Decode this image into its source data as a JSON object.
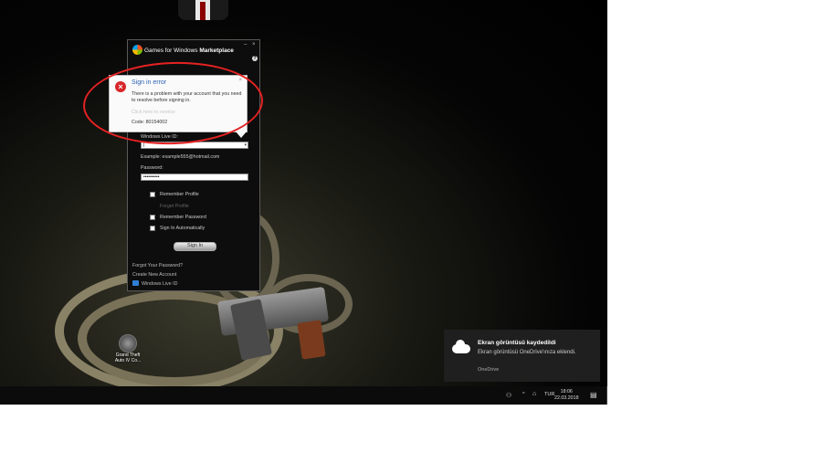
{
  "gfwl": {
    "title_prefix": "Games for Windows",
    "title_bold": "Marketplace",
    "minimize_glyph": "–",
    "close_glyph": "×",
    "help_glyph": "?",
    "live_id_label": "Windows Live ID:",
    "live_id_value": "|",
    "example_text": "Example: example555@hotmail.com",
    "password_label": "Password:",
    "password_value": "••••••••••",
    "remember_profile": "Remember Profile",
    "forget_profile": "Forget Profile",
    "remember_password": "Remember Password",
    "sign_in_auto": "Sign In Automatically",
    "sign_in_button": "Sign In",
    "forgot_password": "Forgot Your Password?",
    "create_account": "Create New Account",
    "windows_live_id": "Windows Live ID"
  },
  "error": {
    "title": "Sign in error",
    "close_glyph": "×",
    "message": "There is a problem with your account that you need to resolve before signing in.",
    "resolve_link": "Click here to resolve",
    "code": "Code: 80154002"
  },
  "desktop_icon": {
    "label_line1": "Grand Theft",
    "label_line2": "Auto IV Co..."
  },
  "toast": {
    "title": "Ekran görüntüsü kaydedildi",
    "body": "Ekran görüntüsü OneDrive'ınıza eklendi.",
    "source": "OneDrive"
  },
  "taskbar": {
    "people_glyph": "⚇",
    "chevron_glyph": "^",
    "language": "TUR",
    "time": "18:06",
    "date": "22.03.2018",
    "notif_glyph": "▤"
  },
  "colors": {
    "annotation": "#e52222",
    "error_title": "#2a5fb0",
    "error_icon": "#d7262a"
  }
}
